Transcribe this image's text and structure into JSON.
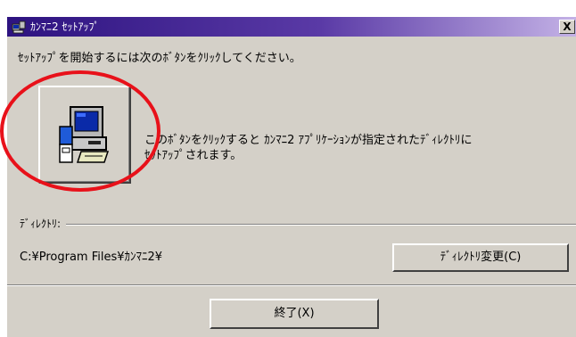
{
  "window": {
    "title": "ｶﾝﾏﾆ2 ｾｯﾄｱｯﾌﾟ",
    "close_label": "X"
  },
  "main": {
    "instruction": "ｾｯﾄｱｯﾌﾟを開始するには次のﾎﾞﾀﾝをｸﾘｯｸしてください。",
    "description_line1": "このﾎﾞﾀﾝをｸﾘｯｸすると ｶﾝﾏﾆ2 ｱﾌﾟﾘｹｰｼｮﾝが指定されたﾃﾞｨﾚｸﾄﾘに",
    "description_line2": "ｾｯﾄｱｯﾌﾟされます。"
  },
  "directory": {
    "group_label": "ﾃﾞｨﾚｸﾄﾘ:",
    "path": "C:¥Program Files¥ｶﾝﾏﾆ2¥",
    "change_button_label": "ﾃﾞｨﾚｸﾄﾘ変更(C)"
  },
  "footer": {
    "exit_button_label": "終了(X)"
  },
  "colors": {
    "dialog_face": "#d4d0c8",
    "titlebar_start": "#2d1380",
    "titlebar_end": "#c4b2e6",
    "annotation_red": "#e8111a"
  },
  "icons": {
    "setup_button_icon": "computer-setup-icon",
    "title_icon": "setup-app-icon"
  }
}
